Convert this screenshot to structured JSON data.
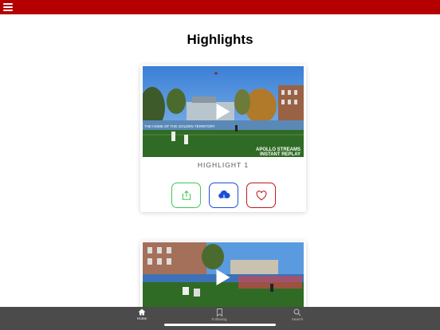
{
  "header": {
    "title": "Highlights",
    "menu_icon": "hamburger-menu-icon"
  },
  "cards": [
    {
      "caption": "HIGHLIGHT 1",
      "overlay_text_1": "APOLLO STREAMS",
      "overlay_text_2": "INSTANT REPLAY",
      "banner_text": "THE HOME OF THE GOLDEN TERRITORY"
    },
    {
      "caption": ""
    }
  ],
  "tabbar": {
    "items": [
      {
        "label": "Home",
        "icon": "home-icon",
        "active": true
      },
      {
        "label": "Following",
        "icon": "bookmark-icon",
        "active": false
      },
      {
        "label": "Search",
        "icon": "search-icon",
        "active": false
      }
    ]
  },
  "colors": {
    "brand": "#b50000",
    "share": "#3cc856",
    "download": "#1a4fd8",
    "favorite": "#c4161c",
    "tabbar": "#4b4b4b"
  }
}
